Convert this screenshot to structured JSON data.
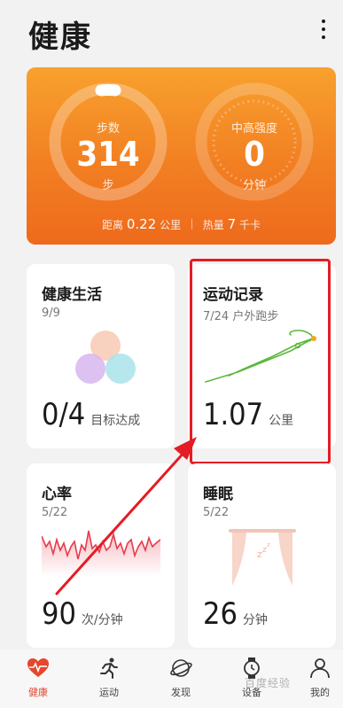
{
  "app": {
    "title": "健康"
  },
  "summary": {
    "steps": {
      "label": "步数",
      "value": "314",
      "unit": "步"
    },
    "intensity": {
      "label": "中高强度",
      "value": "0",
      "unit": "分钟"
    },
    "distance": {
      "label": "距离",
      "value": "0.22",
      "unit": "公里"
    },
    "calories": {
      "label": "热量",
      "value": "7",
      "unit": "千卡"
    },
    "steps_progress": 0.08
  },
  "tiles": {
    "life": {
      "title": "健康生活",
      "date": "9/9",
      "value": "0/4",
      "unit": "目标达成"
    },
    "sport": {
      "title": "运动记录",
      "date": "7/24 户外跑步",
      "value": "1.07",
      "unit": "公里"
    },
    "heart": {
      "title": "心率",
      "date": "5/22",
      "value": "90",
      "unit": "次/分钟"
    },
    "sleep": {
      "title": "睡眠",
      "date": "5/22",
      "value": "26",
      "unit": "分钟"
    }
  },
  "nav": [
    {
      "label": "健康",
      "icon": "heart-pulse-icon",
      "active": true
    },
    {
      "label": "运动",
      "icon": "runner-icon",
      "active": false
    },
    {
      "label": "发现",
      "icon": "planet-icon",
      "active": false
    },
    {
      "label": "设备",
      "icon": "watch-icon",
      "active": false
    },
    {
      "label": "我的",
      "icon": "person-icon",
      "active": false
    }
  ],
  "watermark": "百度经验",
  "colors": {
    "accent": "#f27f22",
    "highlight": "#e51c24",
    "heart": "#e5462c"
  }
}
